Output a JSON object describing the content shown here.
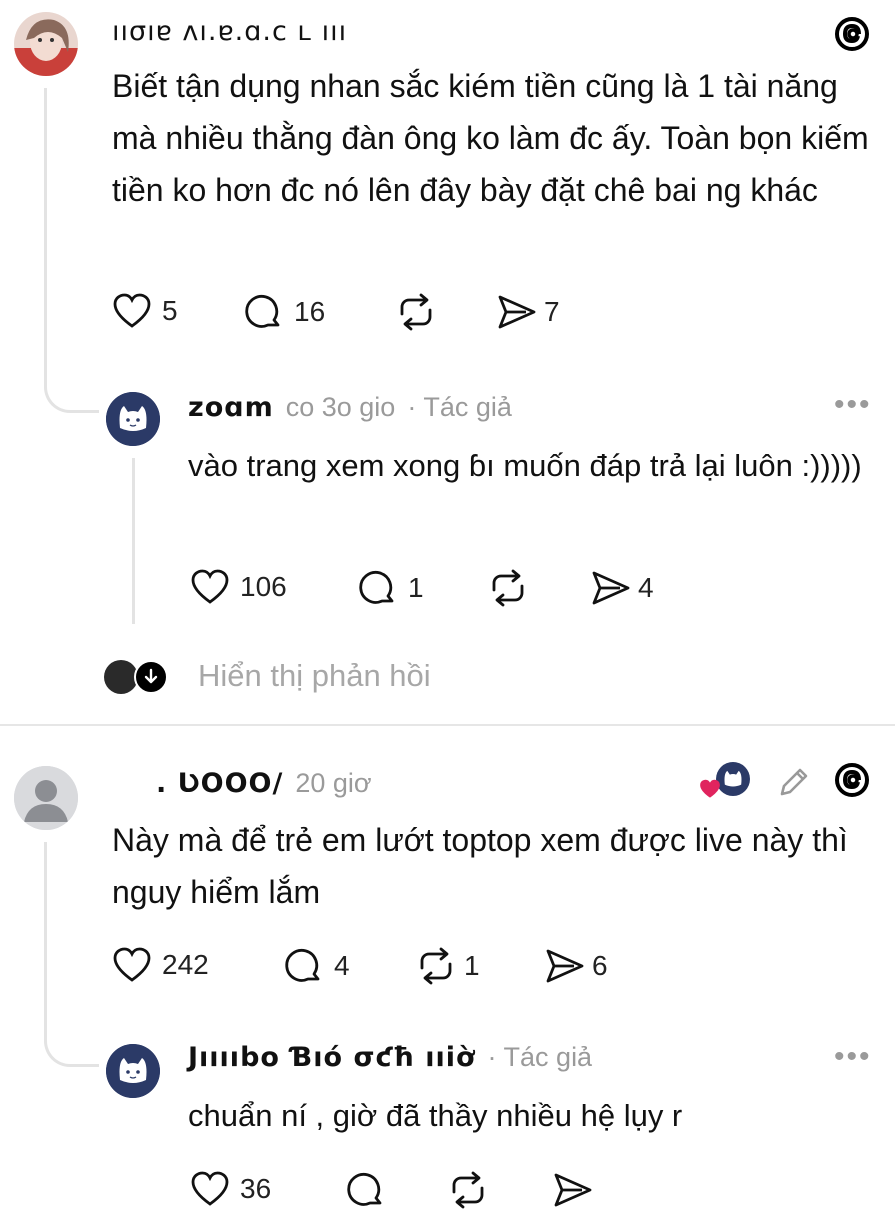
{
  "threads_logo": "@",
  "comments": [
    {
      "username": "ııσıɐ ʌı.ɐ.ɑ.с ʟ ııı",
      "text": "Biết tận dụng nhan sắc kiém tiền cũng là 1 tài năng mà nhiều thằng đàn ông ko làm đc ấy. Toàn bọn kiếm tiền ko hơn đc nó lên đây bày đặt chê bai ng khác",
      "likes": "5",
      "replies": "16",
      "reposts": "",
      "shares": "7"
    },
    {
      "username": "zoɑm",
      "time": "co 3o gio",
      "author_tag": "· Tác giả",
      "text": "vào trang xem xong ɓı muốn đáp trả lại luôn :)))))",
      "likes": "106",
      "replies": "1",
      "reposts": "",
      "shares": "4"
    },
    {
      "show_replies": "Hiển thị phản hồi"
    },
    {
      "username": ". ƲOOO/",
      "time": "20 giơ",
      "text": "Này mà để trẻ em lướt toptop xem được live này thì nguy hiểm lắm",
      "likes": "242",
      "replies": "4",
      "reposts": "1",
      "shares": "6"
    },
    {
      "username": "Jııııbo Ɓıó σƈħ ııiờ",
      "author_tag": "· Tác giả",
      "text": "chuẩn ní , giờ đã thầy nhiều hệ lụy r",
      "likes": "36",
      "replies": "",
      "reposts": "",
      "shares": ""
    }
  ],
  "colors": {
    "text": "#111111",
    "meta": "#9a9a9a",
    "line": "#e3e3e3",
    "heart": "#e0245e",
    "avatar_navy": "#2b3a67"
  }
}
